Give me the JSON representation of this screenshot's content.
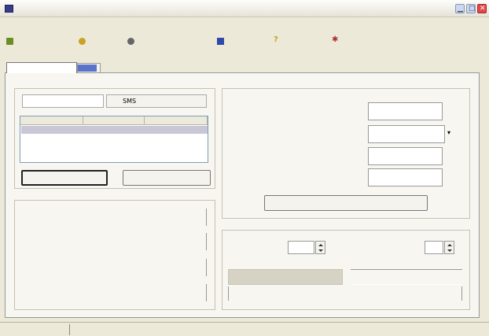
{
  "window": {
    "title": ""
  },
  "menu": {
    "items": [
      "",
      ""
    ]
  },
  "toolbar": {
    "items": [
      {
        "icon": "bottle-icon",
        "label": ""
      },
      {
        "icon": "key-icon",
        "label": ""
      },
      {
        "icon": "gear-icon",
        "label": ""
      },
      {
        "icon": "window-icon",
        "label": ""
      },
      {
        "icon": "help-icon",
        "label": ""
      },
      {
        "icon": "star-icon",
        "label": ""
      }
    ]
  },
  "tabs": [
    "",
    ""
  ],
  "left_panel": {
    "group_title": "",
    "subtabs": [
      "",
      "SMS"
    ],
    "columns": [
      "",
      "",
      ""
    ],
    "selected_row": [
      "",
      "",
      ""
    ],
    "primary_button": "",
    "secondary_button": ""
  },
  "right_panel": {
    "group_title": "",
    "fields": [
      {
        "label": ""
      },
      {
        "label": ""
      },
      {
        "label": ""
      },
      {
        "label": ""
      }
    ],
    "action_button": ""
  },
  "lower_left": {
    "group_title": "",
    "rows": [
      {
        "label": "",
        "value": ""
      },
      {
        "label": "",
        "value": ""
      },
      {
        "label": "",
        "value": ""
      },
      {
        "label": "",
        "value": ""
      }
    ]
  },
  "lower_right": {
    "group_title": "",
    "spinner_left_label": "",
    "spinner_left_value": "",
    "spinner_right_label": "",
    "spinner_right_value": "",
    "button_left": "",
    "button_right": ""
  },
  "statusbar": {
    "cells": [
      "",
      "",
      ""
    ]
  },
  "colors": {
    "progress_fill": "#d6d3c4",
    "selection": "#c9c6d6",
    "close_button": "#e04848"
  }
}
